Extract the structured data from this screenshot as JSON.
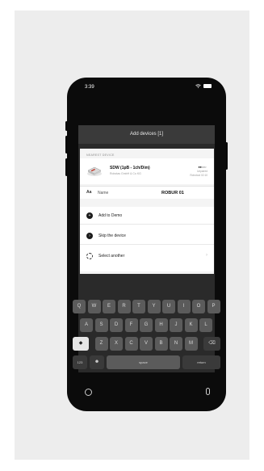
{
  "status_bar": {
    "time": "3:39"
  },
  "modal": {
    "title": "Add devices [1]"
  },
  "sheet": {
    "section_label": "NEAREST DEVICE",
    "device": {
      "name": "SDW (1pB - 1ch/Dim)",
      "maker": "Robotas GmbH & Co KG",
      "signal_dots": "●●○○○",
      "status_line1": "Unpaired",
      "status_line2": "Robotool 02:10"
    },
    "name_field": {
      "icon": "Aa",
      "label": "Name",
      "value": "ROBUR 01"
    },
    "actions": [
      {
        "label": "Add to Demo",
        "icon": "plus-icon"
      },
      {
        "label": "Skip the device",
        "icon": "skip-icon"
      },
      {
        "label": "Select another",
        "icon": "select-icon"
      }
    ]
  },
  "keyboard": {
    "row1": [
      "Q",
      "W",
      "E",
      "R",
      "T",
      "Y",
      "U",
      "I",
      "O",
      "P"
    ],
    "row2": [
      "A",
      "S",
      "D",
      "F",
      "G",
      "H",
      "J",
      "K",
      "L"
    ],
    "row3": [
      "Z",
      "X",
      "C",
      "V",
      "B",
      "N",
      "M"
    ],
    "shift": "◆",
    "backspace": "⌫",
    "num_key": "123",
    "emoji_key": "☻",
    "space_key": "space",
    "return_key": "return"
  }
}
